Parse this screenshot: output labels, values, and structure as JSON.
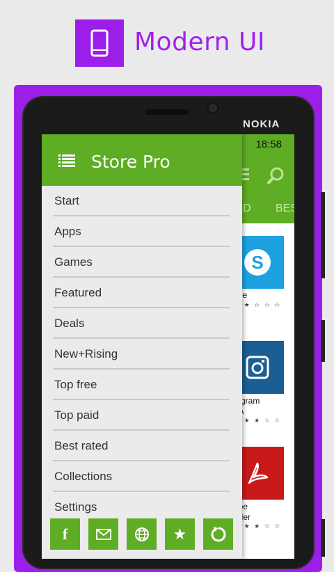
{
  "header": {
    "title": "Modern UI",
    "tile_icon": "phone-icon"
  },
  "device": {
    "brand": "NOKIA"
  },
  "status_bar": {
    "time": "18:58"
  },
  "store_background": {
    "tabs": [
      "AID",
      "BES"
    ],
    "apps": [
      {
        "name": "ype",
        "stars": "★ ★ ☆ ☆ ☆",
        "price": "e",
        "tile_color": "#1da1e0",
        "icon": "skype-icon"
      },
      {
        "name": "tagram",
        "name2": "TA",
        "stars": "★ ★ ★ ☆ ☆",
        "price": "e",
        "tile_color": "#1b5e93",
        "icon": "instagram-icon"
      },
      {
        "name": "obe",
        "name2": "ader",
        "stars": "★ ★ ★ ☆ ☆",
        "price": "e",
        "tile_color": "#c8191a",
        "icon": "pdf-icon"
      }
    ]
  },
  "drawer": {
    "title": "Store Pro",
    "menu_icon": "list-icon",
    "items": [
      {
        "label": "Start"
      },
      {
        "label": "Apps"
      },
      {
        "label": "Games"
      },
      {
        "label": "Featured"
      },
      {
        "label": "Deals"
      },
      {
        "label": "New+Rising"
      },
      {
        "label": "Top free"
      },
      {
        "label": "Top paid"
      },
      {
        "label": "Best rated"
      },
      {
        "label": "Collections"
      },
      {
        "label": "Settings"
      }
    ],
    "bottom_buttons": [
      {
        "icon": "facebook-icon",
        "glyph": "f"
      },
      {
        "icon": "mail-icon"
      },
      {
        "icon": "globe-icon"
      },
      {
        "icon": "star-icon",
        "glyph": "★"
      },
      {
        "icon": "sync-icon"
      }
    ]
  },
  "colors": {
    "accent_green": "#5ead25",
    "brand_purple": "#9b1fe8"
  }
}
